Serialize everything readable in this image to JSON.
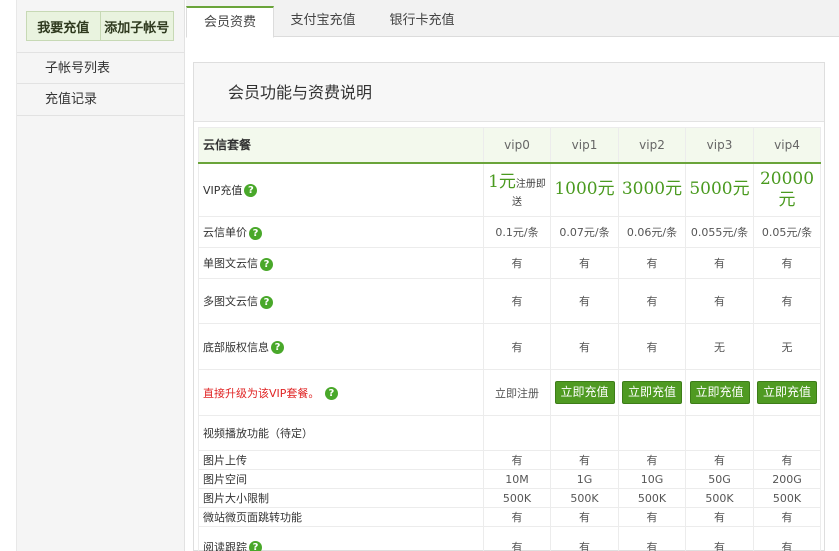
{
  "sidebar": {
    "top_buttons": [
      "我要充值",
      "添加子帐号"
    ],
    "items": [
      "子帐号列表",
      "充值记录"
    ]
  },
  "tabs": [
    "会员资费",
    "支付宝充值",
    "银行卡充值"
  ],
  "panel_title": "会员功能与资费说明",
  "table": {
    "header_label": "云信套餐",
    "plans": [
      "vip0",
      "vip1",
      "vip2",
      "vip3",
      "vip4"
    ],
    "vip_price_label": "VIP充值",
    "vip0_price": "1元",
    "vip0_note": "注册即送",
    "vip_prices": [
      "1000元",
      "3000元",
      "5000元",
      "20000元"
    ],
    "unit_price_label": "云信单价",
    "unit_prices": [
      "0.1元/条",
      "0.07元/条",
      "0.06元/条",
      "0.055元/条",
      "0.05元/条"
    ],
    "rows": [
      {
        "label": "单图文云信",
        "help": true,
        "values": [
          "有",
          "有",
          "有",
          "有",
          "有"
        ]
      },
      {
        "label": "多图文云信",
        "help": true,
        "values": [
          "有",
          "有",
          "有",
          "有",
          "有"
        ]
      },
      {
        "label": "底部版权信息",
        "help": true,
        "values": [
          "有",
          "有",
          "有",
          "无",
          "无"
        ]
      }
    ],
    "upgrade_label": "直接升级为该VIP套餐。",
    "register_now": "立即注册",
    "charge_now": "立即充值",
    "video_section": "视频播放功能",
    "video_section_sub": "（待定）",
    "rows2": [
      {
        "label": "图片上传",
        "values": [
          "有",
          "有",
          "有",
          "有",
          "有"
        ]
      },
      {
        "label": "图片空间",
        "values": [
          "10M",
          "1G",
          "10G",
          "50G",
          "200G"
        ]
      },
      {
        "label": "图片大小限制",
        "values": [
          "500K",
          "500K",
          "500K",
          "500K",
          "500K"
        ]
      },
      {
        "label": "微站微页面跳转功能",
        "values": [
          "有",
          "有",
          "有",
          "有",
          "有"
        ]
      }
    ],
    "last_row_label": "阅读跟踪",
    "last_row_values": [
      "有",
      "有",
      "有",
      "有",
      "有"
    ],
    "help_glyph": "?"
  },
  "colors": {
    "accent": "#6aa43a",
    "button": "#4f9a22",
    "upgrade_text": "#e02424"
  }
}
